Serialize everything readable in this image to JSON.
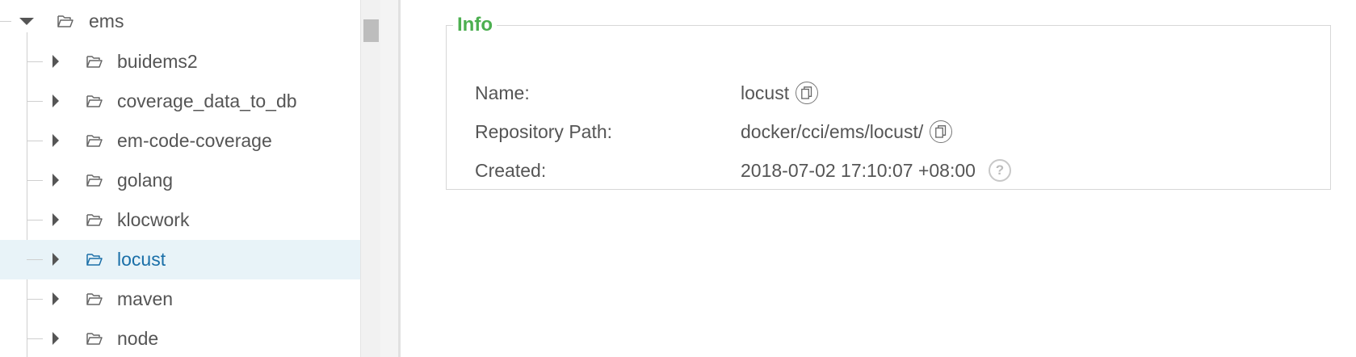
{
  "tree": {
    "root": {
      "label": "ems",
      "expanded": true,
      "icon": "folder-open-icon"
    },
    "children": [
      {
        "label": "buidems2",
        "selected": false
      },
      {
        "label": "coverage_data_to_db",
        "selected": false
      },
      {
        "label": "em-code-coverage",
        "selected": false
      },
      {
        "label": "golang",
        "selected": false
      },
      {
        "label": "klocwork",
        "selected": false
      },
      {
        "label": "locust",
        "selected": true
      },
      {
        "label": "maven",
        "selected": false
      },
      {
        "label": "node",
        "selected": false
      }
    ]
  },
  "info": {
    "legend": "Info",
    "name_label": "Name:",
    "name_value": "locust",
    "path_label": "Repository Path:",
    "path_value": "docker/cci/ems/locust/",
    "created_label": "Created:",
    "created_value": "2018-07-02 17:10:07 +08:00",
    "help_glyph": "?"
  },
  "colors": {
    "legend": "#4caf50",
    "selected_bg": "#e8f3f8",
    "selected_text": "#1a6fa8",
    "text": "#555555"
  }
}
